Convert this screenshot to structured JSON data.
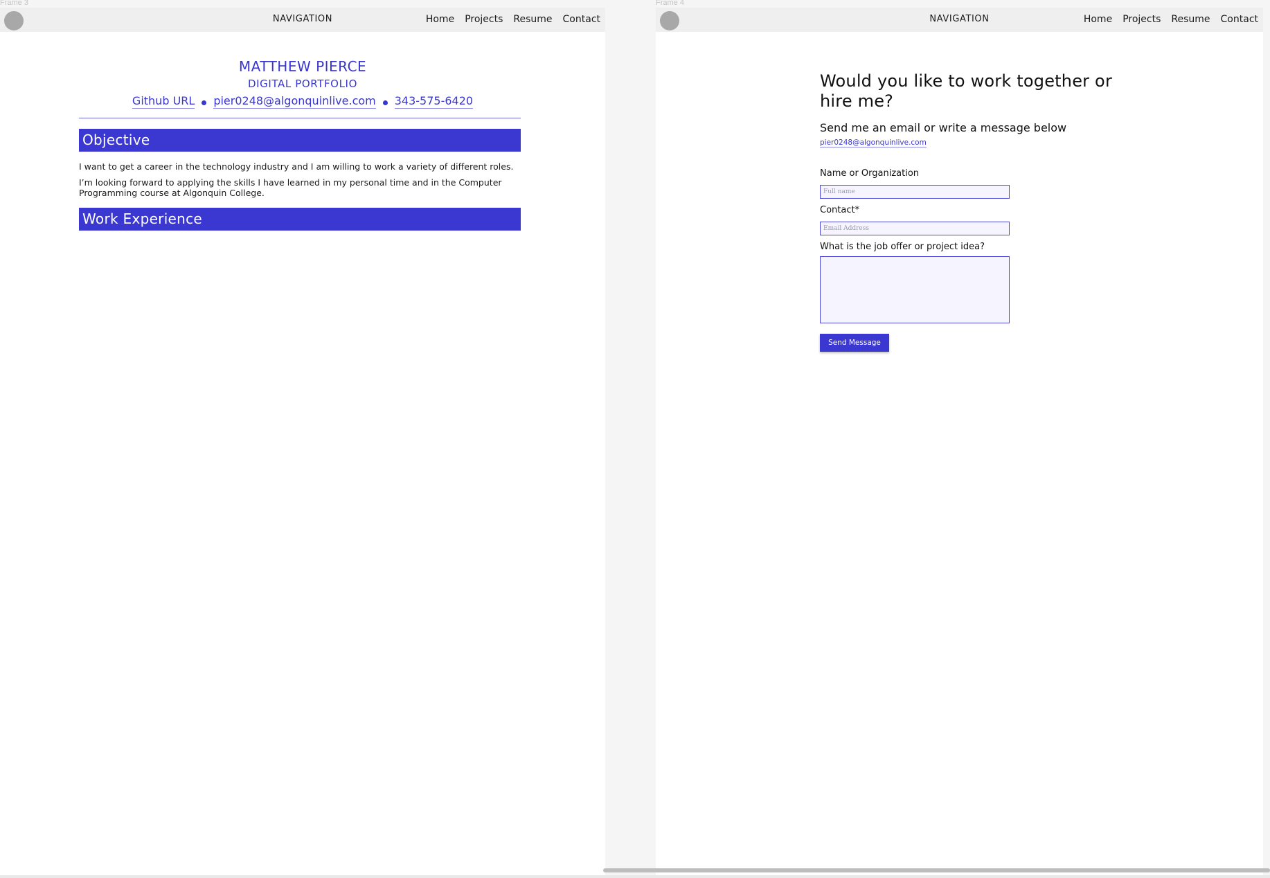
{
  "frames": [
    {
      "label": "Frame 3"
    },
    {
      "label": "Frame 4"
    }
  ],
  "nav": {
    "title": "NAVIGATION",
    "links": [
      "Home",
      "Projects",
      "Resume",
      "Contact"
    ]
  },
  "resume": {
    "name": "MATTHEW PIERCE",
    "subtitle": "DIGITAL PORTFOLIO",
    "github": "Github URL",
    "email": "pier0248@algonquinlive.com",
    "phone": "343-575-6420",
    "objective_heading": "Objective",
    "objective_para1": "I want to get a career in the technology industry and I am willing to work a variety of different roles.",
    "objective_para2": "I’m looking forward to applying the skills I have learned in my personal time and in the Computer Programming course at Algonquin College.",
    "work_heading": "Work Experience"
  },
  "contact": {
    "heading": "Would you like to work together or hire me?",
    "subheading": "Send me an email or write a message below",
    "email": "pier0248@algonquinlive.com",
    "name_label": "Name or Organization",
    "name_placeholder": "Full name",
    "contact_label": "Contact*",
    "contact_placeholder": "Email Address",
    "message_label": "What is the job offer or project idea?",
    "send_label": "Send Message"
  },
  "colors": {
    "accent": "#3b37d1",
    "nav_bg": "#efefef",
    "canvas_bg": "#f5f5f5"
  }
}
